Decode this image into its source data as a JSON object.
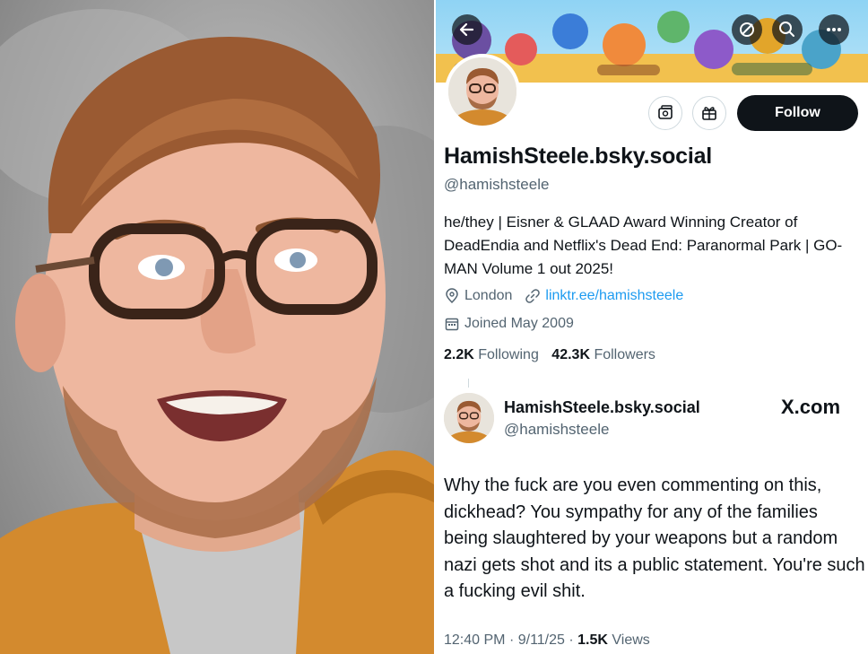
{
  "profile": {
    "display_name": "HamishSteele.bsky.social",
    "handle": "@hamishsteele",
    "bio": "he/they | Eisner & GLAAD Award Winning Creator of DeadEndia and Netflix's Dead End: Paranormal Park | GO-MAN Volume 1 out 2025!",
    "location": "London",
    "link": "linktr.ee/hamishsteele",
    "joined": "Joined May 2009",
    "following_count": "2.2K",
    "following_label": "Following",
    "followers_count": "42.3K",
    "followers_label": "Followers",
    "follow_label": "Follow"
  },
  "header_icons": {
    "back": "arrow-left-icon",
    "grok": "grok-icon",
    "search": "search-icon",
    "more": "more-icon"
  },
  "tweet": {
    "display_name": "HamishSteele.bsky.social",
    "handle": "@hamishsteele",
    "source_label": "X.com",
    "text": "Why the fuck are you even commenting on this, dickhead? You sympathy for any of the families being slaughtered by your weapons but a random nazi gets shot and its a public statement. You're such a fucking evil shit.",
    "time": "12:40 PM",
    "date": "9/11/25",
    "views_count": "1.5K",
    "views_label": "Views"
  },
  "colors": {
    "follow_button": "#0f1419",
    "link": "#1d9bf0",
    "secondary_text": "#536471",
    "jacket": "#d38a2e"
  }
}
